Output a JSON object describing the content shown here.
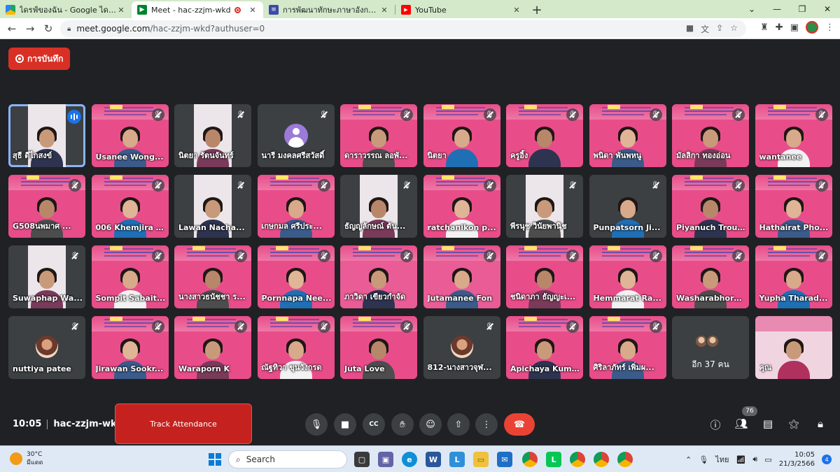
{
  "browser": {
    "tabs": [
      {
        "title": "ไดรฟ์ของฉัน - Google ไดรฟ์",
        "favicon": "drive-icon"
      },
      {
        "title": "Meet - hac-zzjm-wkd",
        "favicon": "meet-icon",
        "active": true
      },
      {
        "title": "การพัฒนาทักษะภาษาอังกฤษ English",
        "favicon": "forms-icon"
      },
      {
        "title": "YouTube",
        "favicon": "youtube-icon"
      }
    ],
    "url_host": "meet.google.com",
    "url_path": "/hac-zzjm-wkd?authuser=0"
  },
  "meet": {
    "record_label": "การบันทึก",
    "participants": [
      {
        "name": "สุธี ดีไกสงข์",
        "style": "dark",
        "speaking": true
      },
      {
        "name": "Usanee Wong...",
        "style": "slide"
      },
      {
        "name": "นิตยา รัตนจันทร์",
        "style": "dark"
      },
      {
        "name": "นารี มงคลศรีสวัสดิ์",
        "style": "avatar"
      },
      {
        "name": "ดาราวรรณ ลอพั...",
        "style": "slide"
      },
      {
        "name": "นิตยา",
        "style": "slide"
      },
      {
        "name": "ครูอิ้ง",
        "style": "slide"
      },
      {
        "name": "พนิดา พันพหนู",
        "style": "slide"
      },
      {
        "name": "มัลลิกา ทองอ่อน",
        "style": "slide"
      },
      {
        "name": "wantanee",
        "style": "slide"
      },
      {
        "name": "G508นพมาศ ...",
        "style": "slide"
      },
      {
        "name": "006 Khemjira l...",
        "style": "slide"
      },
      {
        "name": "Lawan Nacha...",
        "style": "dark"
      },
      {
        "name": "เกษกมล ศรีประ...",
        "style": "slide"
      },
      {
        "name": "ธัญญลักษณ์ ตัน...",
        "style": "dark"
      },
      {
        "name": "ratchanikon p...",
        "style": "slide"
      },
      {
        "name": "พีรนุช วินัยพานิช",
        "style": "dark"
      },
      {
        "name": "Punpatsorn Ji...",
        "style": "dark"
      },
      {
        "name": "Piyanuch Trouj...",
        "style": "slide"
      },
      {
        "name": "Hathairat Pho...",
        "style": "slide"
      },
      {
        "name": "Suwaphap Wa...",
        "style": "dark"
      },
      {
        "name": "Sompit Sabait...",
        "style": "slide"
      },
      {
        "name": "นางสาวธนัชชา ร...",
        "style": "slide"
      },
      {
        "name": "Pornnapa Nee...",
        "style": "slide"
      },
      {
        "name": "ภาวิดา เขียวกำจัด",
        "style": "pink2"
      },
      {
        "name": "Jutamanee Fon",
        "style": "pink2"
      },
      {
        "name": "ชนิดาภา ธัญญะเ...",
        "style": "slide"
      },
      {
        "name": "Hemmarat Ra...",
        "style": "slide"
      },
      {
        "name": "Washarabhorn...",
        "style": "slide"
      },
      {
        "name": "Yupha Tharad...",
        "style": "slide"
      },
      {
        "name": "nuttiya patee",
        "style": "photo"
      },
      {
        "name": "Jirawan Sookr...",
        "style": "slide"
      },
      {
        "name": "Waraporn K",
        "style": "slide"
      },
      {
        "name": "ณัฐทิวา ขุนวังกรด",
        "style": "slide"
      },
      {
        "name": "Juta Love",
        "style": "slide"
      },
      {
        "name": "812-นางสาวจุฬ...",
        "style": "photo"
      },
      {
        "name": "Apichaya Kum...",
        "style": "slide"
      },
      {
        "name": "ศิริลาภัทร์ เพิ่มผ...",
        "style": "slide"
      }
    ],
    "more_label": "อีก 37 คน",
    "self_label": "คุณ",
    "clock": "10:05",
    "meeting_code": "hac-zzjm-wkd",
    "track_attendance_label": "Track Attendance",
    "people_count": "76"
  },
  "taskbar": {
    "temperature": "30°C",
    "weather_desc": "มีแดด",
    "search_placeholder": "Search",
    "lang": "ไทย",
    "time": "10:05",
    "date": "21/3/2566",
    "notifications": "4"
  },
  "colors": {
    "meet_bg": "#202124",
    "tile_dark": "#3c4043",
    "slide_pink": "#e84d8a",
    "record_red": "#d93025",
    "speaker_blue": "#8ab4f8"
  }
}
